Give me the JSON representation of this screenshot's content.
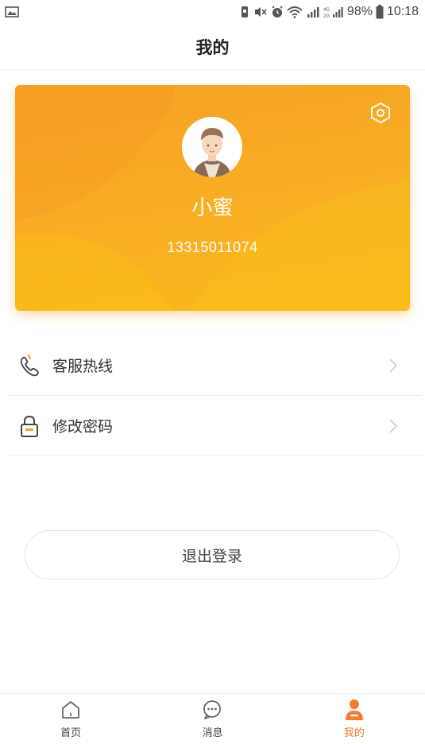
{
  "status_bar": {
    "battery_text": "98%",
    "time": "10:18",
    "icons": [
      "image-icon",
      "vibrate-icon",
      "mute-icon",
      "alarm-icon",
      "wifi-icon",
      "signal-icon",
      "signal-4g-icon",
      "battery-icon"
    ]
  },
  "header": {
    "title": "我的"
  },
  "profile": {
    "name": "小蜜",
    "phone": "13315011074",
    "settings_icon": "settings-hexagon-icon",
    "colors": {
      "card_start": "#f6a124",
      "card_end": "#fbb91a"
    }
  },
  "menu": {
    "items": [
      {
        "label": "客服热线",
        "icon": "phone-icon"
      },
      {
        "label": "修改密码",
        "icon": "lock-icon"
      }
    ]
  },
  "logout": {
    "label": "退出登录"
  },
  "tab_bar": {
    "tabs": [
      {
        "label": "首页",
        "icon": "home-icon",
        "active": false
      },
      {
        "label": "消息",
        "icon": "message-icon",
        "active": false
      },
      {
        "label": "我的",
        "icon": "user-icon",
        "active": true
      }
    ],
    "active_color": "#f5792e"
  }
}
